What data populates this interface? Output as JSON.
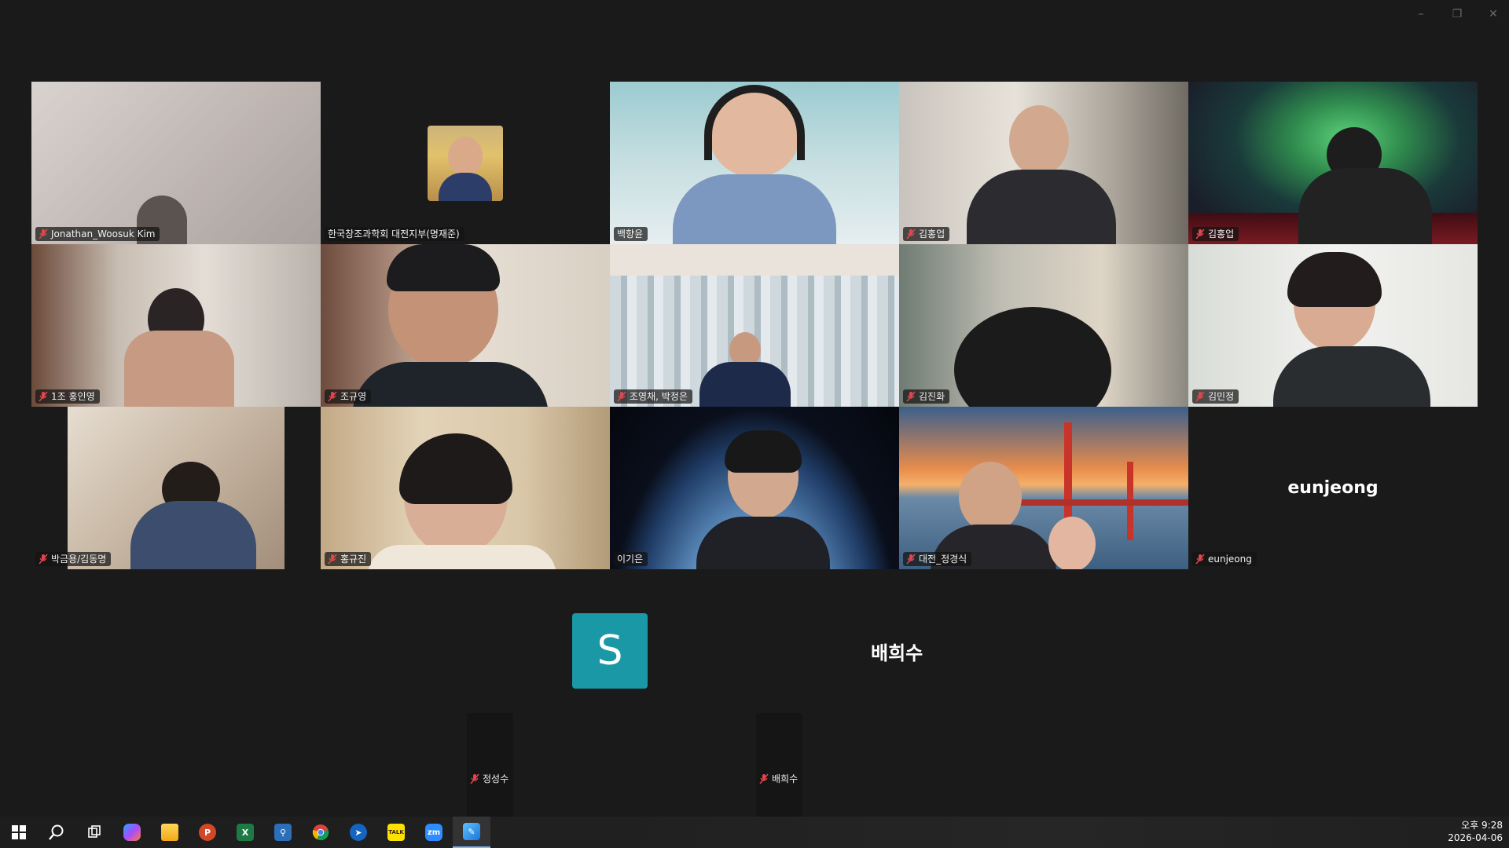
{
  "window": {
    "minimize": "–",
    "restore": "❐",
    "close": "✕"
  },
  "participants": [
    {
      "name": "Jonathan_Woosuk Kim",
      "muted": true,
      "active": false
    },
    {
      "name": "한국창조과학회 대전지부(명재준)",
      "muted": false,
      "active": false
    },
    {
      "name": "백향윤",
      "muted": false,
      "active": true
    },
    {
      "name": "김홍업",
      "muted": true,
      "active": false
    },
    {
      "name": "김홍업",
      "muted": true,
      "active": false
    },
    {
      "name": "1조 홍인영",
      "muted": true,
      "active": false
    },
    {
      "name": "조규영",
      "muted": true,
      "active": false
    },
    {
      "name": "조영채, 박정은",
      "muted": true,
      "active": false
    },
    {
      "name": "김진화",
      "muted": true,
      "active": false
    },
    {
      "name": "김민정",
      "muted": true,
      "active": false
    },
    {
      "name": "박금용/김동명",
      "muted": true,
      "active": false
    },
    {
      "name": "홍규진",
      "muted": true,
      "active": false
    },
    {
      "name": "이기은",
      "muted": false,
      "active": false
    },
    {
      "name": "대전_정경식",
      "muted": true,
      "active": false
    },
    {
      "name": "eunjeong",
      "muted": true,
      "active": false,
      "display_name": "eunjeong"
    }
  ],
  "lower_row": [
    {
      "name": "정성수",
      "muted": true,
      "avatar_letter": "S",
      "avatar_color": "#1b98a6"
    },
    {
      "name": "배희수",
      "muted": true,
      "display_name": "배희수"
    }
  ],
  "taskbar": {
    "icons": [
      "windows-start-icon",
      "search-icon",
      "task-view-icon",
      "copilot-icon",
      "file-explorer-icon",
      "powerpoint-icon",
      "excel-icon",
      "app-icon",
      "chrome-icon",
      "pinned-app-icon",
      "kakaotalk-icon",
      "zoom-icon",
      "screen-tool-icon"
    ],
    "kakao_label": "TALK",
    "zoom_label": "zm",
    "time": "오후 9:28",
    "date": "2026-04-06"
  },
  "colors": {
    "active_speaker": "#23d96b",
    "mic_off": "#e0474c",
    "background": "#1a1a1a"
  }
}
